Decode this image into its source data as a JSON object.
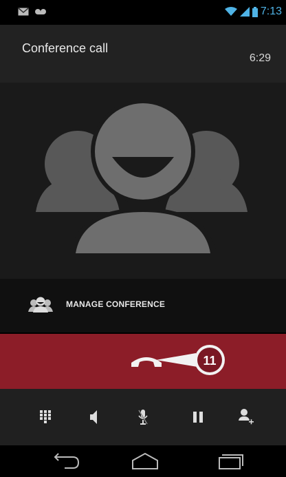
{
  "status_bar": {
    "time": "7:13",
    "icons": [
      "gmail-icon",
      "voicemail-icon",
      "wifi-icon",
      "signal-icon",
      "battery-icon"
    ]
  },
  "call": {
    "caller_name": "Conference call",
    "timer": "6:29"
  },
  "manage_conference": {
    "label": "MANAGE CONFERENCE",
    "icon": "conference-icon"
  },
  "end_call": {
    "icon": "end-call-icon",
    "callout_number": "11"
  },
  "actions": {
    "icons": [
      "dialpad-icon",
      "speaker-icon",
      "mute-icon",
      "hold-icon",
      "add-call-icon"
    ]
  },
  "nav": {
    "icons": [
      "back-icon",
      "home-icon",
      "recents-icon"
    ]
  },
  "colors": {
    "end_call_bar": "#8c1d28",
    "callout": "#7a1824",
    "status_accent": "#4fb3e6"
  }
}
